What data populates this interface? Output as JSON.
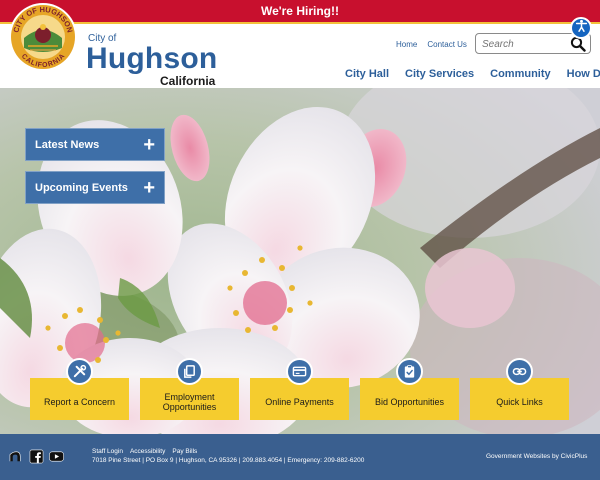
{
  "alert": {
    "text": "We're Hiring!!"
  },
  "brand": {
    "city_of": "City of",
    "name": "Hughson",
    "state": "California",
    "seal_text_top": "CITY OF HUGHSON",
    "seal_text_bottom": "CALIFORNIA",
    "seal_colors": {
      "ring": "#e6a526",
      "center": "#7c1f2c",
      "field": "#4c8b3a"
    }
  },
  "utility_nav": {
    "home": "Home",
    "contact": "Contact Us"
  },
  "search": {
    "placeholder": "Search",
    "icon": "magnifier-icon"
  },
  "main_nav": [
    {
      "label": "City Hall"
    },
    {
      "label": "City Services"
    },
    {
      "label": "Community"
    },
    {
      "label": "How Do I..."
    }
  ],
  "accordions": [
    {
      "label": "Latest News",
      "icon": "plus-icon"
    },
    {
      "label": "Upcoming Events",
      "icon": "plus-icon"
    }
  ],
  "quick_links": [
    {
      "label": "Report a Concern",
      "icon": "tools-icon"
    },
    {
      "label": "Employment Opportunities",
      "icon": "copy-documents-icon"
    },
    {
      "label": "Online Payments",
      "icon": "credit-card-icon"
    },
    {
      "label": "Bid Opportunities",
      "icon": "clipboard-check-icon"
    },
    {
      "label": "Quick Links",
      "icon": "link-icon"
    }
  ],
  "footer": {
    "social": [
      {
        "name": "nextdoor-icon"
      },
      {
        "name": "facebook-icon"
      },
      {
        "name": "youtube-icon"
      }
    ],
    "links": [
      "Staff Login",
      "Accessibility",
      "Pay Bills"
    ],
    "address": "7018 Pine Street | PO Box 9 | Hughson, CA 95326 | 209.883.4054 | Emergency: 209-882-6200",
    "credit": "Government Websites by CivicPlus"
  },
  "colors": {
    "alert_bg": "#c8102e",
    "brand_blue": "#2d5f9a",
    "accordion_bg": "#3e6fa8",
    "quick_link_bg": "#f5cc2e",
    "footer_bg": "#3a5f8f"
  }
}
